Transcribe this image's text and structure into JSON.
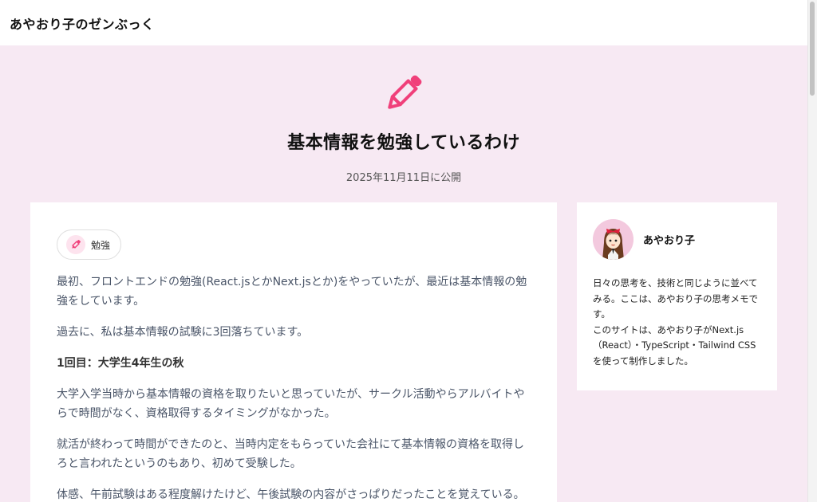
{
  "header": {
    "site_title": "あやおり子のゼンぶっく"
  },
  "hero": {
    "icon": "pencil-icon",
    "title": "基本情報を勉強しているわけ",
    "date": "2025年11月11日に公開"
  },
  "article": {
    "tag": {
      "icon": "pencil-icon",
      "label": "勉強"
    },
    "paragraphs": [
      "最初、フロントエンドの勉強(React.jsとかNext.jsとか)をやっていたが、最近は基本情報の勉強をしています。",
      "過去に、私は基本情報の試験に3回落ちています。",
      "1回目：大学生4年生の秋",
      "大学入学当時から基本情報の資格を取りたいと思っていたが、サークル活動やらアルバイトやらで時間がなく、資格取得するタイミングがなかった。",
      "就活が終わって時間ができたのと、当時内定をもらっていた会社にて基本情報の資格を取得しろと言われたというのもあり、初めて受験した。",
      "体感、午前試験はある程度解けたけど、午後試験の内容がさっぱりだったことを覚えている。"
    ]
  },
  "sidebar": {
    "name": "あやおり子",
    "bio_1": "日々の思考を、技術と同じように並べてみる。ここは、あやおり子の思考メモです。",
    "bio_2": "このサイトは、あやおり子がNext.js（React）・TypeScript・Tailwind CSSを使って制作しました。"
  },
  "colors": {
    "accent": "#f0407a",
    "background": "#f7e9f3"
  }
}
